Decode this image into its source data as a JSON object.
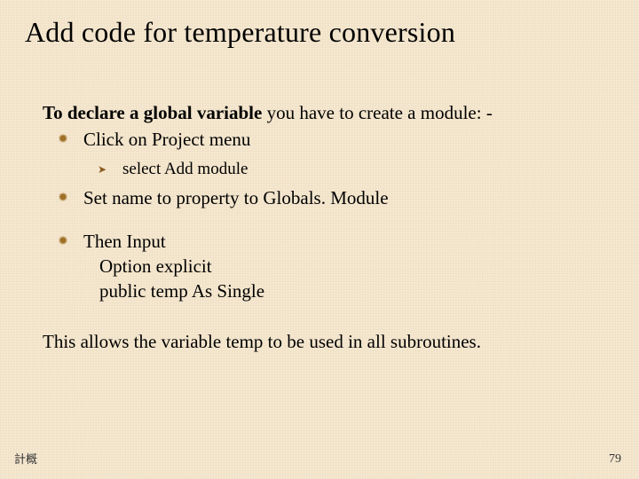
{
  "title": "Add code for temperature conversion",
  "intro_bold": "To declare a global variable",
  "intro_rest": " you have to create a module: -",
  "bullets": {
    "b1": "Click on Project menu",
    "b1_sub": "select Add   module",
    "b2": "Set name to property to Globals. Module",
    "b3": "Then Input",
    "b3_line1": "Option explicit",
    "b3_line2": "public temp As Single"
  },
  "closing": "This allows the variable temp to be used in all subroutines.",
  "footer_left": "計概",
  "footer_right": "79"
}
